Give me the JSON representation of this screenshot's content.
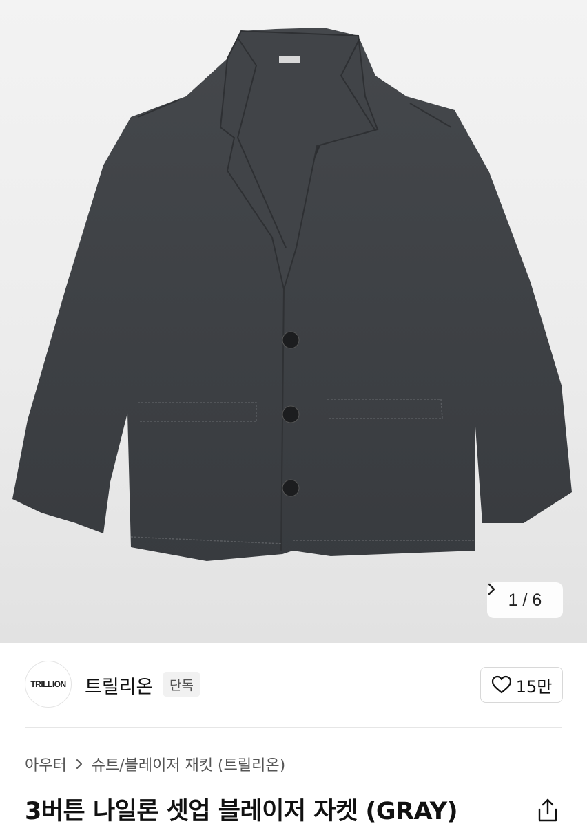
{
  "product_image": {
    "description_icon": "jacket-photo",
    "counter_current": "1",
    "counter_separator": "/",
    "counter_total": "6"
  },
  "brand": {
    "logo_text": "TRILLION",
    "name": "트릴리온",
    "badge": "단독"
  },
  "like": {
    "count": "15만",
    "icon": "heart-outline-icon"
  },
  "breadcrumb": {
    "level1": "아우터",
    "level2": "슈트/블레이저 재킷 (트릴리온)"
  },
  "product": {
    "title": "3버튼 나일론 셋업 블레이저 자켓 (GRAY)"
  },
  "colors": {
    "jacket": "#3d4044",
    "background": "#efefef",
    "text": "#111111",
    "muted": "#555555"
  }
}
